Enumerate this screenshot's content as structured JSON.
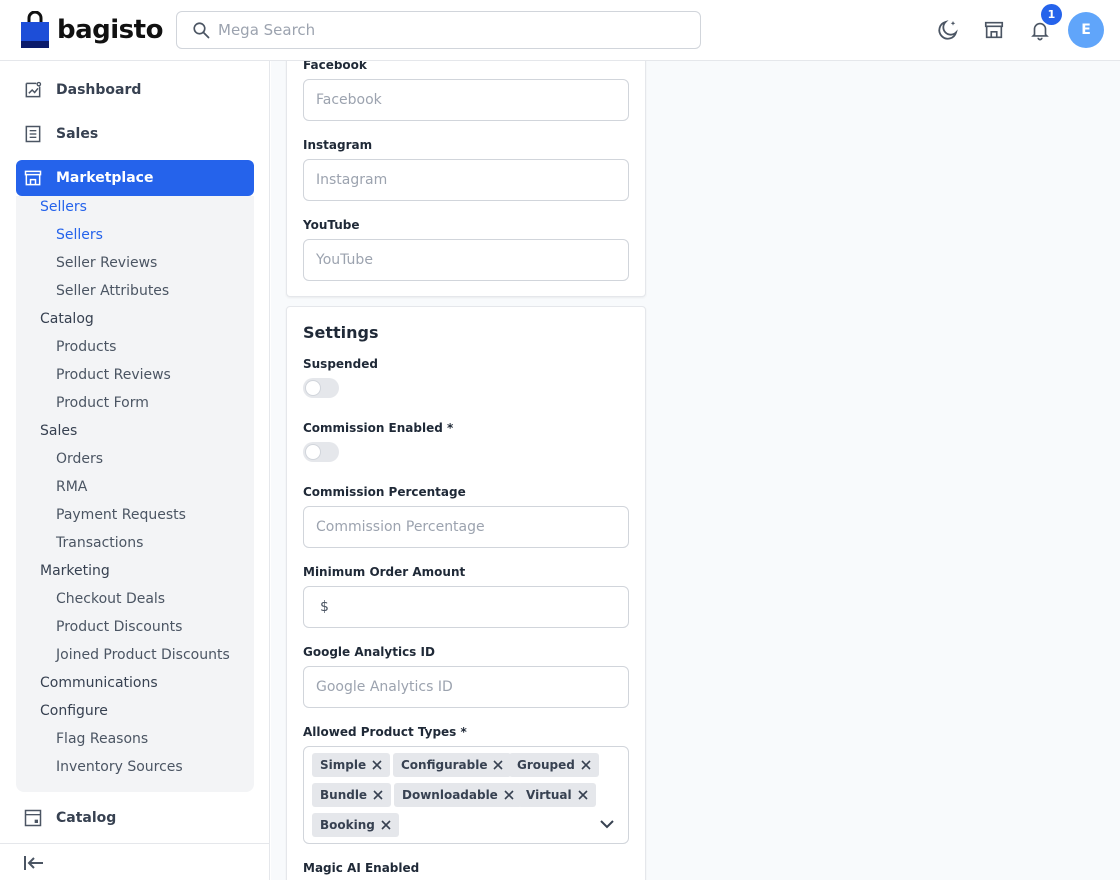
{
  "header": {
    "brand": "bagisto",
    "search_placeholder": "Mega Search",
    "notification_count": "1",
    "avatar_initial": "E"
  },
  "sidebar": {
    "top_items": [
      {
        "label": "Dashboard",
        "icon": "dashboard-icon"
      },
      {
        "label": "Sales",
        "icon": "sales-icon"
      },
      {
        "label": "Marketplace",
        "icon": "store-icon"
      }
    ],
    "submenu": [
      {
        "label": "Sellers",
        "level": 1,
        "selected": true
      },
      {
        "label": "Sellers",
        "level": 2,
        "selected": true
      },
      {
        "label": "Seller Reviews",
        "level": 2
      },
      {
        "label": "Seller Attributes",
        "level": 2
      },
      {
        "label": "Catalog",
        "level": 1
      },
      {
        "label": "Products",
        "level": 2
      },
      {
        "label": "Product Reviews",
        "level": 2
      },
      {
        "label": "Product Form",
        "level": 2
      },
      {
        "label": "Sales",
        "level": 1
      },
      {
        "label": "Orders",
        "level": 2
      },
      {
        "label": "RMA",
        "level": 2
      },
      {
        "label": "Payment Requests",
        "level": 2
      },
      {
        "label": "Transactions",
        "level": 2
      },
      {
        "label": "Marketing",
        "level": 1
      },
      {
        "label": "Checkout Deals",
        "level": 2
      },
      {
        "label": "Product Discounts",
        "level": 2
      },
      {
        "label": "Joined Product Discounts",
        "level": 2
      },
      {
        "label": "Communications",
        "level": 1
      },
      {
        "label": "Configure",
        "level": 1
      },
      {
        "label": "Flag Reasons",
        "level": 2
      },
      {
        "label": "Inventory Sources",
        "level": 2
      }
    ],
    "catalog_label": "Catalog"
  },
  "social": {
    "facebook_label": "Facebook",
    "facebook_placeholder": "Facebook",
    "instagram_label": "Instagram",
    "instagram_placeholder": "Instagram",
    "youtube_label": "YouTube",
    "youtube_placeholder": "YouTube"
  },
  "settings": {
    "title": "Settings",
    "suspended_label": "Suspended",
    "commission_enabled_label": "Commission Enabled *",
    "commission_percentage_label": "Commission Percentage",
    "commission_percentage_placeholder": "Commission Percentage",
    "min_order_label": "Minimum Order Amount",
    "min_order_value": "$",
    "ga_label": "Google Analytics ID",
    "ga_placeholder": "Google Analytics ID",
    "product_types_label": "Allowed Product Types *",
    "product_types": [
      "Simple",
      "Configurable",
      "Grouped",
      "Bundle",
      "Downloadable",
      "Virtual",
      "Booking"
    ],
    "magic_ai_label": "Magic AI Enabled"
  },
  "colors": {
    "accent": "#2563eb",
    "avatar": "#60a5fa"
  }
}
